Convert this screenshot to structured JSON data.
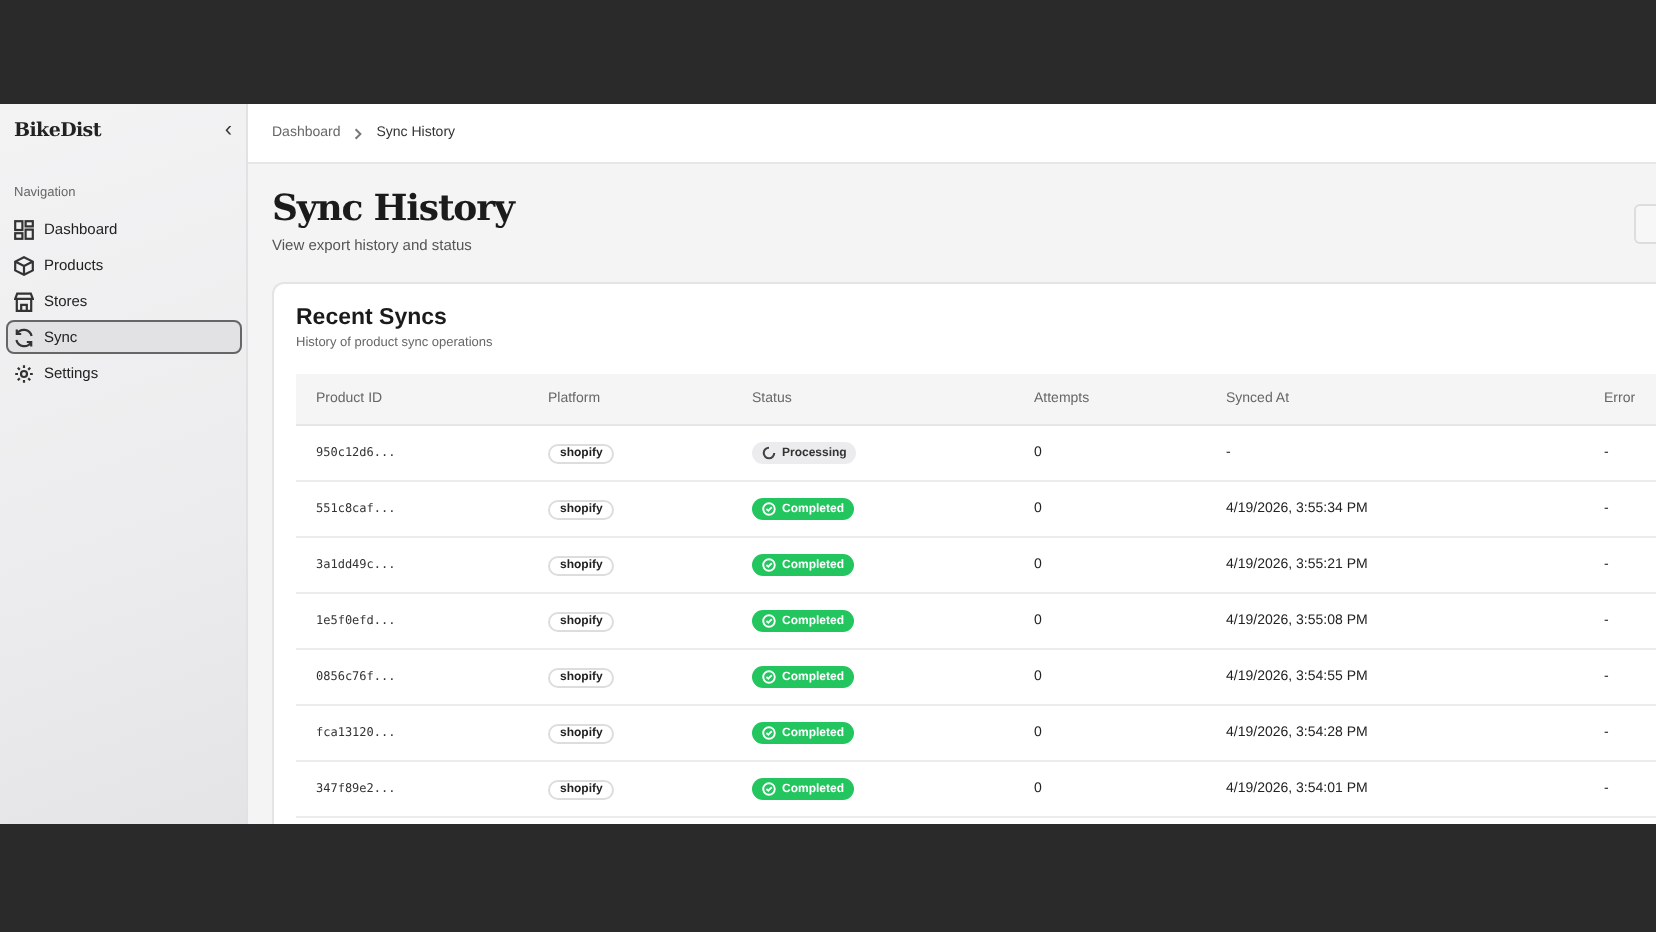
{
  "sidebar": {
    "brand": "BikeDist",
    "collapse_icon": "‹",
    "section_label": "Navigation",
    "items": [
      {
        "label": "Dashboard",
        "selected": false
      },
      {
        "label": "Products",
        "selected": false
      },
      {
        "label": "Stores",
        "selected": false
      },
      {
        "label": "Sync",
        "selected": true
      },
      {
        "label": "Settings",
        "selected": false
      }
    ]
  },
  "breadcrumb": [
    "Dashboard",
    "Sync History"
  ],
  "header": {
    "title": "Sync History",
    "subtitle": "View export history and status"
  },
  "card": {
    "title": "Recent Syncs",
    "subtitle": "History of product sync operations"
  },
  "table": {
    "columns": [
      "Product ID",
      "Platform",
      "Status",
      "Attempts",
      "Synced At",
      "Error"
    ],
    "rows": [
      {
        "id": "950c12d6...",
        "platform": "shopify",
        "status": {
          "kind": "processing",
          "label": "Processing"
        },
        "attempts": "0",
        "synced_at": "-",
        "error": "-"
      },
      {
        "id": "551c8caf...",
        "platform": "shopify",
        "status": {
          "kind": "completed",
          "label": "Completed"
        },
        "attempts": "0",
        "synced_at": "4/19/2026, 3:55:34 PM",
        "error": "-"
      },
      {
        "id": "3a1dd49c...",
        "platform": "shopify",
        "status": {
          "kind": "completed",
          "label": "Completed"
        },
        "attempts": "0",
        "synced_at": "4/19/2026, 3:55:21 PM",
        "error": "-"
      },
      {
        "id": "1e5f0efd...",
        "platform": "shopify",
        "status": {
          "kind": "completed",
          "label": "Completed"
        },
        "attempts": "0",
        "synced_at": "4/19/2026, 3:55:08 PM",
        "error": "-"
      },
      {
        "id": "0856c76f...",
        "platform": "shopify",
        "status": {
          "kind": "completed",
          "label": "Completed"
        },
        "attempts": "0",
        "synced_at": "4/19/2026, 3:54:55 PM",
        "error": "-"
      },
      {
        "id": "fca13120...",
        "platform": "shopify",
        "status": {
          "kind": "completed",
          "label": "Completed"
        },
        "attempts": "0",
        "synced_at": "4/19/2026, 3:54:28 PM",
        "error": "-"
      },
      {
        "id": "347f89e2...",
        "platform": "shopify",
        "status": {
          "kind": "completed",
          "label": "Completed"
        },
        "attempts": "0",
        "synced_at": "4/19/2026, 3:54:01 PM",
        "error": "-"
      }
    ]
  }
}
